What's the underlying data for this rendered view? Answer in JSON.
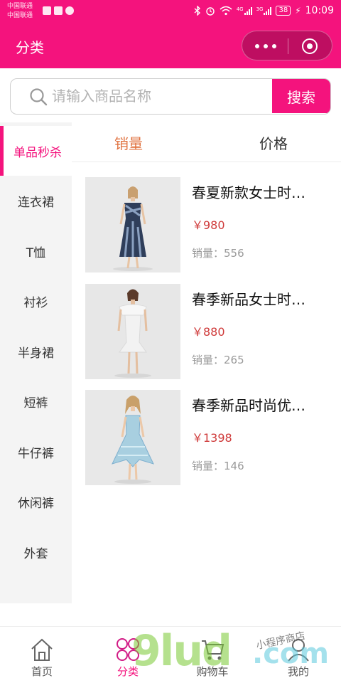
{
  "status_bar": {
    "carrier_1": "中国联通",
    "carrier_2": "中国联通",
    "signal_1_label": "4G",
    "signal_2_label": "3G",
    "battery": "38",
    "time": "10:09"
  },
  "nav": {
    "title": "分类",
    "more_icon": "more-dots-icon",
    "close_icon": "target-circle-icon"
  },
  "search": {
    "placeholder": "请输入商品名称",
    "value": "",
    "button_label": "搜索"
  },
  "categories": [
    {
      "label": "单品秒杀",
      "active": true
    },
    {
      "label": "连衣裙",
      "active": false
    },
    {
      "label": "T恤",
      "active": false
    },
    {
      "label": "衬衫",
      "active": false
    },
    {
      "label": "半身裙",
      "active": false
    },
    {
      "label": "短裤",
      "active": false
    },
    {
      "label": "牛仔裤",
      "active": false
    },
    {
      "label": "休闲裤",
      "active": false
    },
    {
      "label": "外套",
      "active": false
    }
  ],
  "sort": {
    "sales_label": "销量",
    "price_label": "价格"
  },
  "products": [
    {
      "name": "春夏新款女士时…",
      "price": "￥980",
      "sales": "销量：556",
      "dress_colors": [
        "#2f3e5a",
        "#8aa0c0"
      ]
    },
    {
      "name": "春季新品女士时…",
      "price": "￥880",
      "sales": "销量：265",
      "dress_colors": [
        "#f2f2f2",
        "#dcdcdc"
      ]
    },
    {
      "name": "春季新品时尚优…",
      "price": "￥1398",
      "sales": "销量：146",
      "dress_colors": [
        "#a8cfe0",
        "#7fb0cf"
      ]
    }
  ],
  "tab_bar": {
    "home": "首页",
    "category": "分类",
    "cart": "购物车",
    "mine": "我的"
  },
  "watermark": {
    "big": "9lud",
    "com": ".com",
    "small": "小程序商店"
  },
  "colors": {
    "brand": "#f4137d",
    "sales_tab": "#e0723f",
    "price": "#cf3b3b"
  }
}
